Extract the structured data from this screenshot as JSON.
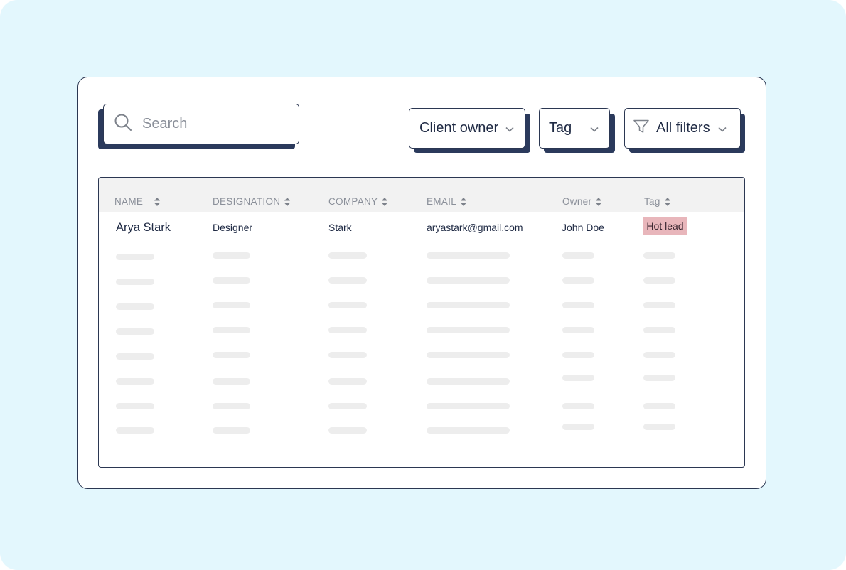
{
  "search": {
    "placeholder": "Search",
    "value": ""
  },
  "filters": {
    "client_owner_label": "Client owner",
    "tag_label": "Tag",
    "all_filters_label": "All filters"
  },
  "table": {
    "columns": [
      "NAME",
      "DESIGNATION",
      "COMPANY",
      "EMAIL",
      "Owner",
      "Tag"
    ],
    "rows": [
      {
        "name": "Arya Stark",
        "designation": "Designer",
        "company": "Stark",
        "email": "aryastark@gmail.com",
        "owner": "John Doe",
        "tag": "Hot lead"
      }
    ]
  },
  "colors": {
    "background": "#e3f7fd",
    "accent_dark": "#2b3a5c",
    "tag_hot_lead": "#e8b6bb",
    "header_bg": "#f2f2f2"
  },
  "icons": {
    "search": "search-icon",
    "chevron": "chevron-down-icon",
    "filter": "filter-funnel-icon",
    "sort": "sort-icon"
  }
}
